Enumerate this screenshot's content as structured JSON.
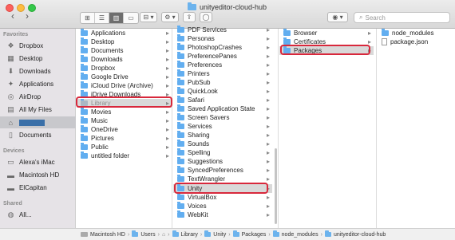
{
  "window": {
    "title": "unityeditor-cloud-hub",
    "search_placeholder": "Search"
  },
  "toolbar": {
    "back": "‹",
    "forward": "›",
    "view_icons": "⊞",
    "view_list": "☰",
    "view_columns": "▥",
    "view_gallery": "▭",
    "group": "⊟ ▾",
    "action": "⚙ ▾",
    "share": "⇪",
    "tags": "◯",
    "arrange": "◉ ▾"
  },
  "sidebar": {
    "favorites_header": "Favorites",
    "favorites": [
      {
        "label": "Dropbox",
        "icon": "dropbox-icon"
      },
      {
        "label": "Desktop",
        "icon": "desktop-icon"
      },
      {
        "label": "Downloads",
        "icon": "downloads-icon"
      },
      {
        "label": "Applications",
        "icon": "applications-icon"
      },
      {
        "label": "AirDrop",
        "icon": "airdrop-icon"
      },
      {
        "label": "All My Files",
        "icon": "all-my-files-icon"
      },
      {
        "label": "",
        "icon": "home-icon"
      },
      {
        "label": "Documents",
        "icon": "documents-icon"
      }
    ],
    "devices_header": "Devices",
    "devices": [
      {
        "label": "Alexa's iMac",
        "icon": "imac-icon"
      },
      {
        "label": "Macintosh HD",
        "icon": "disk-icon"
      },
      {
        "label": "ElCapitan",
        "icon": "disk-icon"
      }
    ],
    "shared_header": "Shared",
    "shared": [
      {
        "label": "All...",
        "icon": "network-icon"
      }
    ]
  },
  "columns": {
    "c1": [
      "Applications",
      "Desktop",
      "Documents",
      "Downloads",
      "Dropbox",
      "Google Drive",
      "iCloud Drive (Archive)",
      "iDrive Downloads",
      "Library",
      "Movies",
      "Music",
      "OneDrive",
      "Pictures",
      "Public",
      "untitled folder"
    ],
    "c2": [
      "PDF Services",
      "Personas",
      "PhotoshopCrashes",
      "PreferencePanes",
      "Preferences",
      "Printers",
      "PubSub",
      "QuickLook",
      "Safari",
      "Saved Application State",
      "Screen Savers",
      "Services",
      "Sharing",
      "Sounds",
      "Spelling",
      "Suggestions",
      "SyncedPreferences",
      "TextWrangler",
      "Unity",
      "VirtualBox",
      "Voices",
      "WebKit"
    ],
    "c3": [
      "Browser",
      "Certificates",
      "Packages"
    ],
    "c4": [
      "node_modules",
      "package.json"
    ]
  },
  "pathbar": [
    "Macintosh HD",
    "Users",
    "",
    "Library",
    "Unity",
    "Packages",
    "node_modules",
    "unityeditor-cloud-hub"
  ],
  "colors": {
    "highlight": "#d8283c",
    "folder": "#62aef0"
  }
}
